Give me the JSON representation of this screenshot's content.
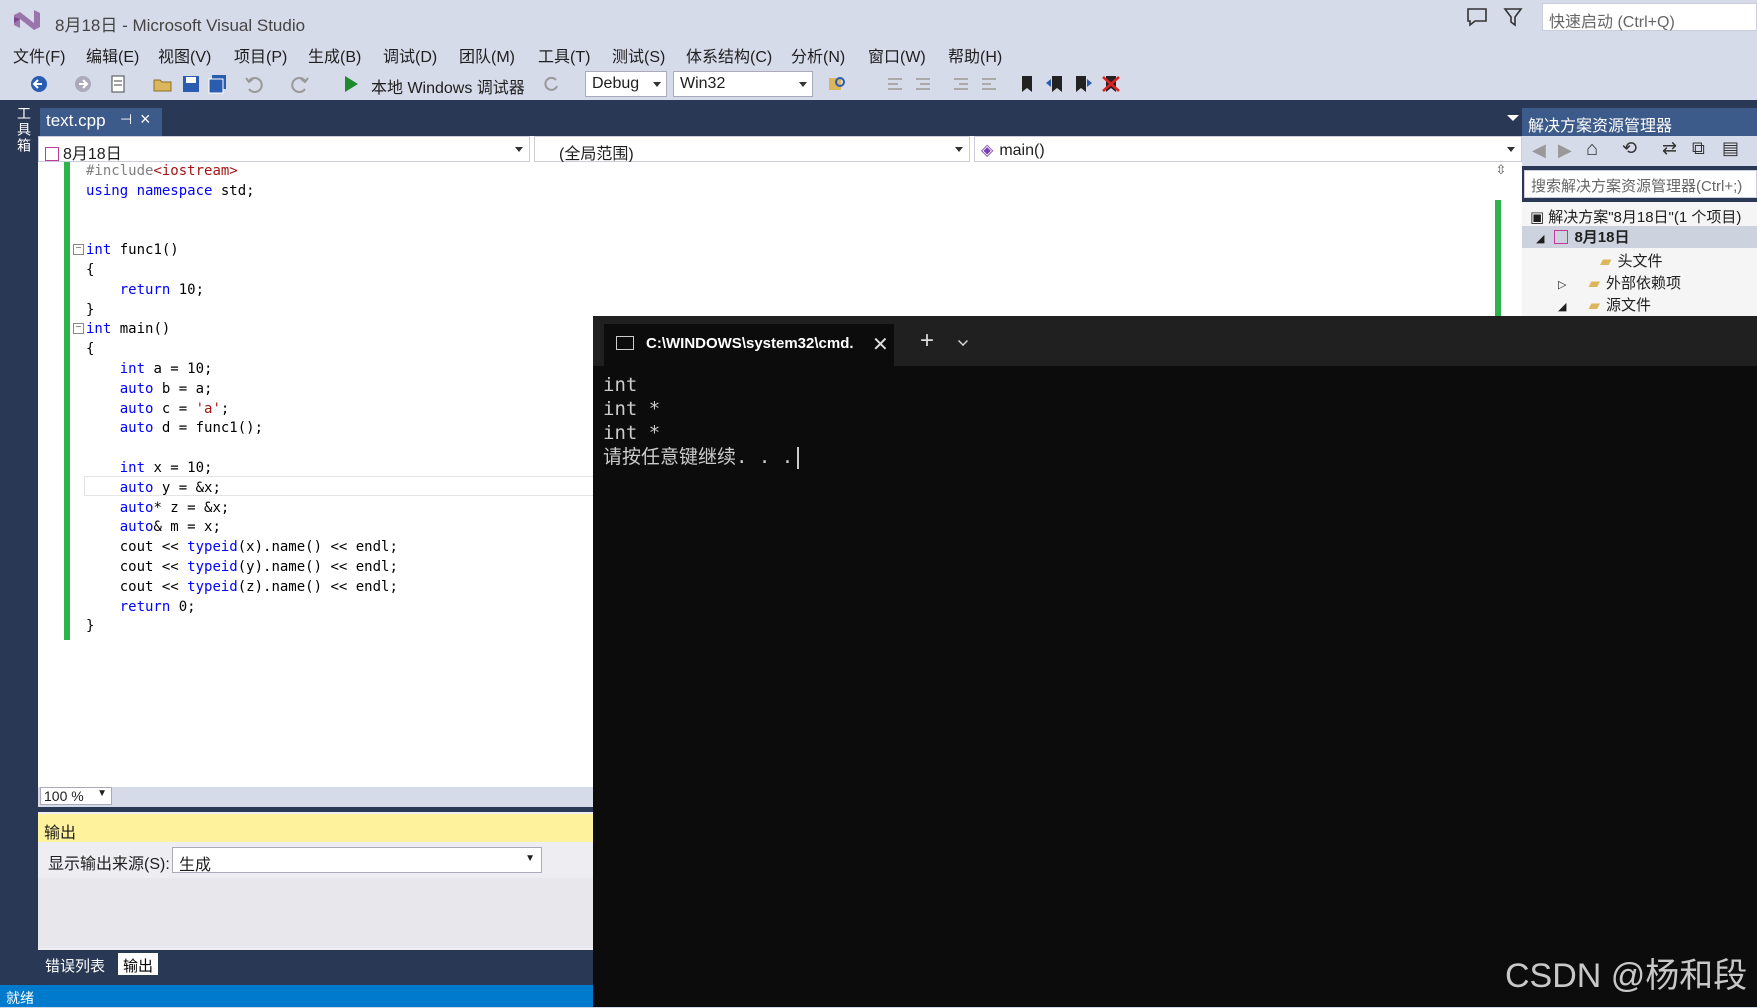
{
  "window": {
    "title": "8月18日 - Microsoft Visual Studio",
    "quick_launch_placeholder": "快速启动 (Ctrl+Q)"
  },
  "menu": [
    "文件(F)",
    "编辑(E)",
    "视图(V)",
    "项目(P)",
    "生成(B)",
    "调试(D)",
    "团队(M)",
    "工具(T)",
    "测试(S)",
    "体系结构(C)",
    "分析(N)",
    "窗口(W)",
    "帮助(H)"
  ],
  "toolbar": {
    "run_label": "本地 Windows 调试器",
    "config": "Debug",
    "platform": "Win32"
  },
  "toolbox_label": "工具箱",
  "editor": {
    "tab_name": "text.cpp",
    "nav_project": "8月18日",
    "nav_scope": "(全局范围)",
    "nav_member": "main()",
    "zoom": "100 %"
  },
  "output": {
    "title": "输出",
    "source_label": "显示输出来源(S):",
    "source_value": "生成"
  },
  "bottom_tabs": [
    "错误列表",
    "输出"
  ],
  "status": "就绪",
  "solution_explorer": {
    "title": "解决方案资源管理器",
    "search_placeholder": "搜索解决方案资源管理器(Ctrl+;)",
    "solution": "解决方案\"8月18日\"(1 个项目)",
    "project": "8月18日",
    "items": [
      "头文件",
      "外部依赖项",
      "源文件"
    ]
  },
  "cmd": {
    "tab_title": "C:\\WINDOWS\\system32\\cmd.",
    "lines": [
      "int",
      "int *",
      "int *",
      "请按任意键继续. . ."
    ]
  },
  "watermark": "CSDN @杨和段",
  "colors": {
    "accent": "#007acc",
    "frame": "#293955",
    "change_bar": "#2fb34a",
    "keyword": "#0000ff",
    "string": "#a31515"
  }
}
